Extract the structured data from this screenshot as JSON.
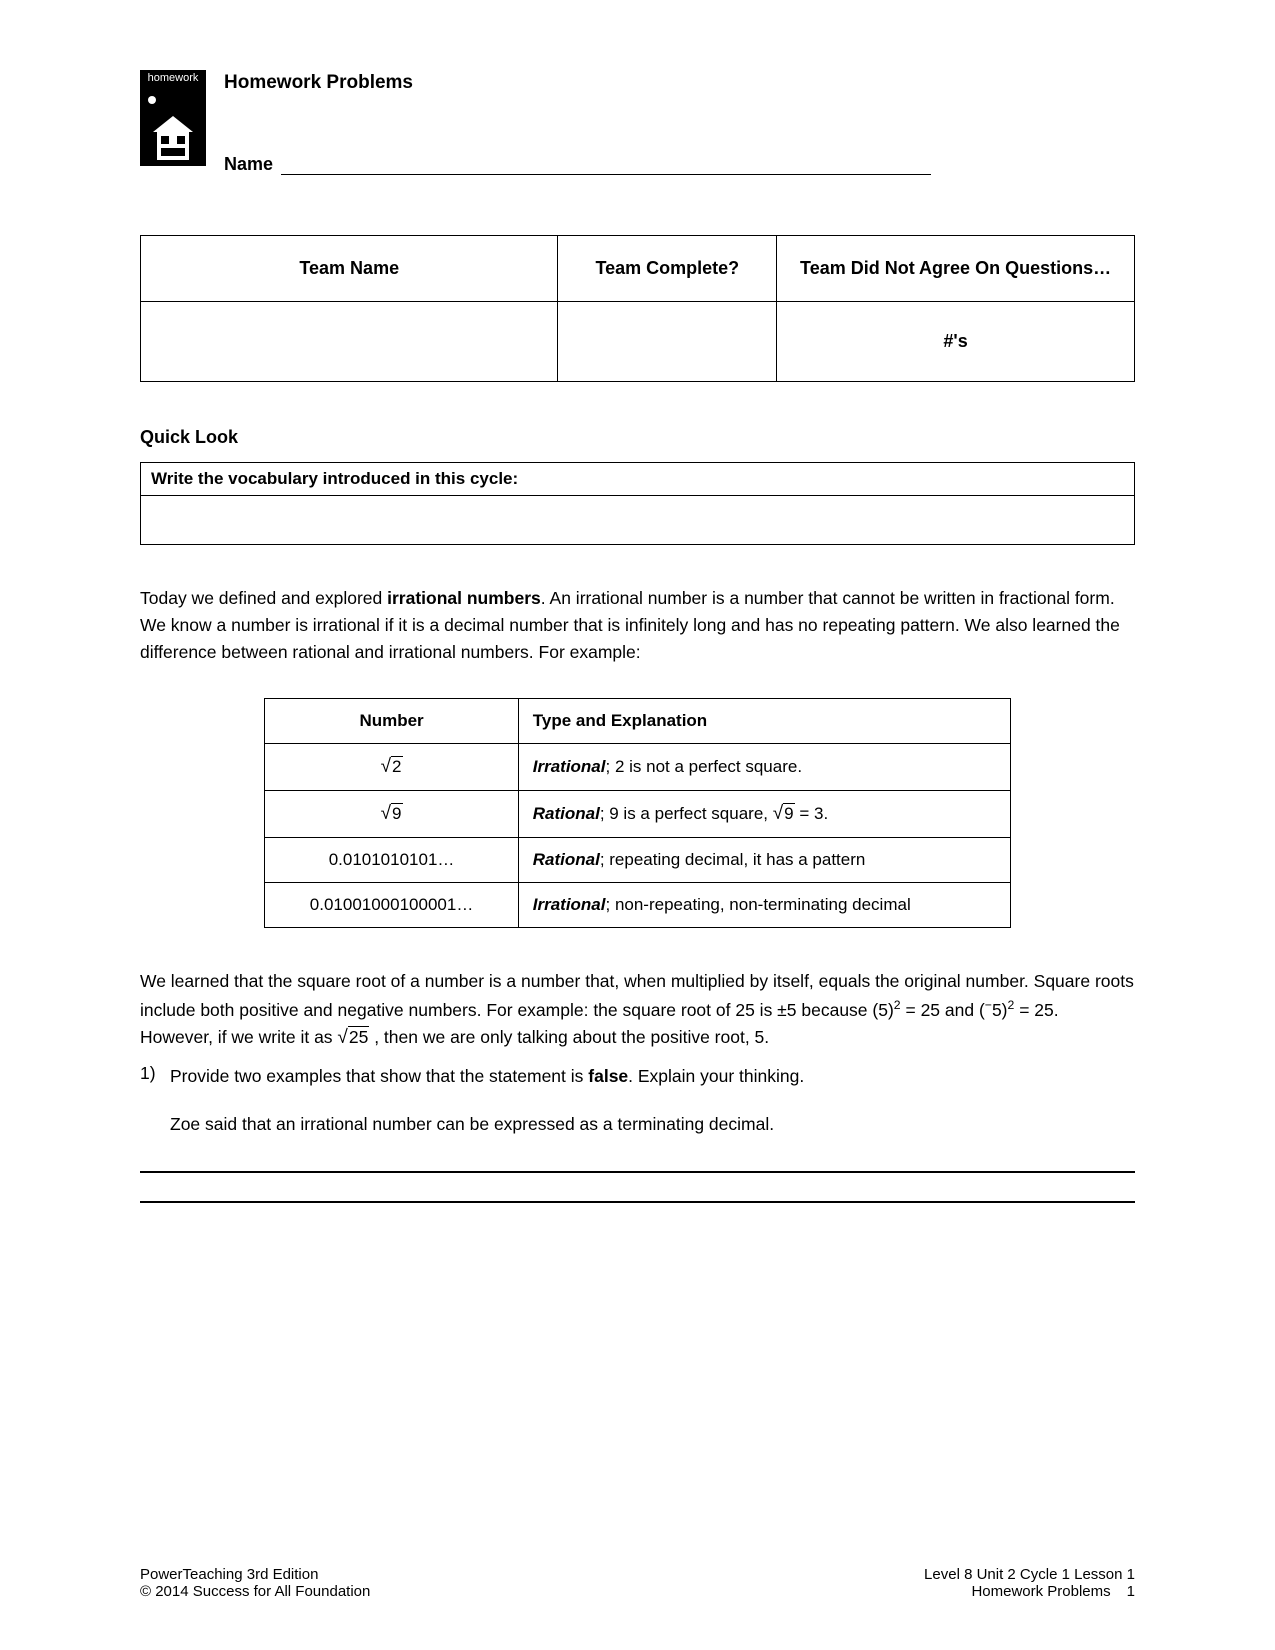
{
  "icon": {
    "label": "homework"
  },
  "header": {
    "title": "Homework Problems",
    "name_label": "Name"
  },
  "team_table": {
    "col1": "Team Name",
    "col2": "Team Complete?",
    "col3": "Team Did Not Agree On Questions…",
    "numbers_label": "#'s"
  },
  "quick_look": {
    "heading": "Quick Look",
    "vocab_prompt": "Write the vocabulary introduced in this cycle:"
  },
  "paragraph1": {
    "part1": "Today we defined and explored ",
    "bold1": "irrational numbers",
    "part2": ". An irrational number is a number that cannot be written in fractional form. We know a number is irrational if it is a decimal number that is infinitely long and has no repeating pattern. We also learned the difference between rational and irrational numbers. For example:"
  },
  "example_table": {
    "header_number": "Number",
    "header_type": "Type and Explanation",
    "rows": [
      {
        "number_type": "sqrt",
        "number_value": "2",
        "type_bold": "Irrational",
        "type_rest": "; 2 is not a perfect square."
      },
      {
        "number_type": "sqrt",
        "number_value": "9",
        "type_bold": "Rational",
        "type_rest_pre": "; 9 is a perfect square, ",
        "type_sqrt_val": "9",
        "type_rest_post": " = 3."
      },
      {
        "number_type": "text",
        "number_value": "0.0101010101…",
        "type_bold": "Rational",
        "type_rest": "; repeating decimal, it has a pattern"
      },
      {
        "number_type": "text",
        "number_value": "0.01001000100001…",
        "type_bold": "Irrational",
        "type_rest": "; non-repeating, non-terminating decimal"
      }
    ]
  },
  "paragraph2": {
    "part1": "We learned that the square root of a number is a number that, when multiplied by itself, equals the original number. Square roots include both positive and negative numbers. For example: the square root of 25 is ±5 because (5)",
    "sup1": "2",
    "part2": " = 25 and (",
    "neg": "−",
    "part2b": "5)",
    "sup2": "2",
    "part3": " = 25. However, if we write it as ",
    "sqrt_val": "25",
    "part4": " , then we are only talking about the positive root, 5."
  },
  "question1": {
    "num": "1)",
    "text_pre": "Provide two examples that show that the statement is ",
    "text_bold": "false",
    "text_post": ". Explain your thinking.",
    "sub": "Zoe said that an irrational number can be expressed as a terminating decimal."
  },
  "footer": {
    "left1": "PowerTeaching 3rd Edition",
    "left2": "© 2014 Success for All Foundation",
    "right1": "Level 8 Unit 2 Cycle 1 Lesson 1",
    "right2": "Homework Problems",
    "page": "1"
  }
}
